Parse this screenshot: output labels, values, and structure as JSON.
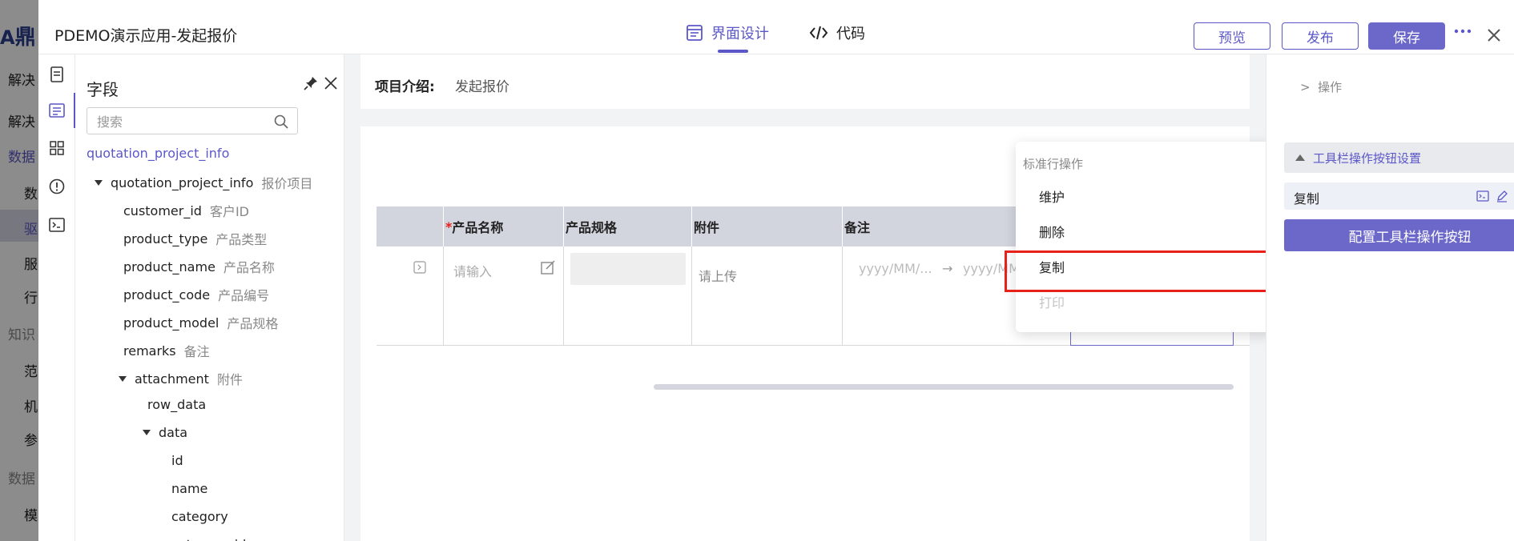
{
  "background": {
    "logo_text": "鼎",
    "items": [
      "解决",
      "解决",
      "数据",
      "数",
      "驱",
      "服",
      "行",
      "知识",
      "范",
      "机",
      "参",
      "数据",
      "模"
    ]
  },
  "header": {
    "app_title": "PDEMO演示应用-发起报价",
    "tabs": [
      {
        "label": "界面设计",
        "active": true
      },
      {
        "label": "代码",
        "active": false
      }
    ],
    "preview_label": "预览",
    "publish_label": "发布",
    "save_label": "保存"
  },
  "fields_panel": {
    "title": "字段",
    "search_placeholder": "搜索",
    "root_link": "quotation_project_info",
    "tree": [
      {
        "name": "quotation_project_info",
        "cn": "报价项目",
        "level": 0,
        "expanded": true
      },
      {
        "name": "customer_id",
        "cn": "客户ID",
        "level": 1
      },
      {
        "name": "product_type",
        "cn": "产品类型",
        "level": 1
      },
      {
        "name": "product_name",
        "cn": "产品名称",
        "level": 1
      },
      {
        "name": "product_code",
        "cn": "产品编号",
        "level": 1
      },
      {
        "name": "product_model",
        "cn": "产品规格",
        "level": 1
      },
      {
        "name": "remarks",
        "cn": "备注",
        "level": 1
      },
      {
        "name": "attachment",
        "cn": "附件",
        "level": 1,
        "expanded": true
      },
      {
        "name": "row_data",
        "cn": "",
        "level": 2
      },
      {
        "name": "data",
        "cn": "",
        "level": 2,
        "expanded": true
      },
      {
        "name": "id",
        "cn": "",
        "level": 3
      },
      {
        "name": "name",
        "cn": "",
        "level": 3
      },
      {
        "name": "category",
        "cn": "",
        "level": 3
      },
      {
        "name": "category_id",
        "cn": "",
        "level": 3
      }
    ]
  },
  "canvas": {
    "intro_label": "项目介绍:",
    "intro_value": "发起报价",
    "table": {
      "required_mark": "*",
      "columns": [
        "产品名称",
        "产品规格",
        "附件",
        "备注"
      ],
      "input_placeholder": "请输入",
      "upload_placeholder": "请上传",
      "date_start_placeholder": "yyyy/MM/...",
      "date_arrow": "→",
      "date_end_placeholder": "yyyy/MM"
    }
  },
  "dropdown": {
    "group_title": "标准行操作",
    "items": [
      {
        "label": "维护",
        "disabled": false
      },
      {
        "label": "删除",
        "disabled": false
      },
      {
        "label": "复制",
        "disabled": false
      },
      {
        "label": "打印",
        "disabled": true
      }
    ]
  },
  "right_panel": {
    "breadcrumb_sep": ">",
    "breadcrumb": "操作",
    "section_title": "工具栏操作按钮设置",
    "item_label": "复制",
    "config_button": "配置工具栏操作按钮"
  },
  "colors": {
    "accent": "#5b57c8",
    "accent_solid": "#6c68c9",
    "highlight": "#e8201a"
  }
}
